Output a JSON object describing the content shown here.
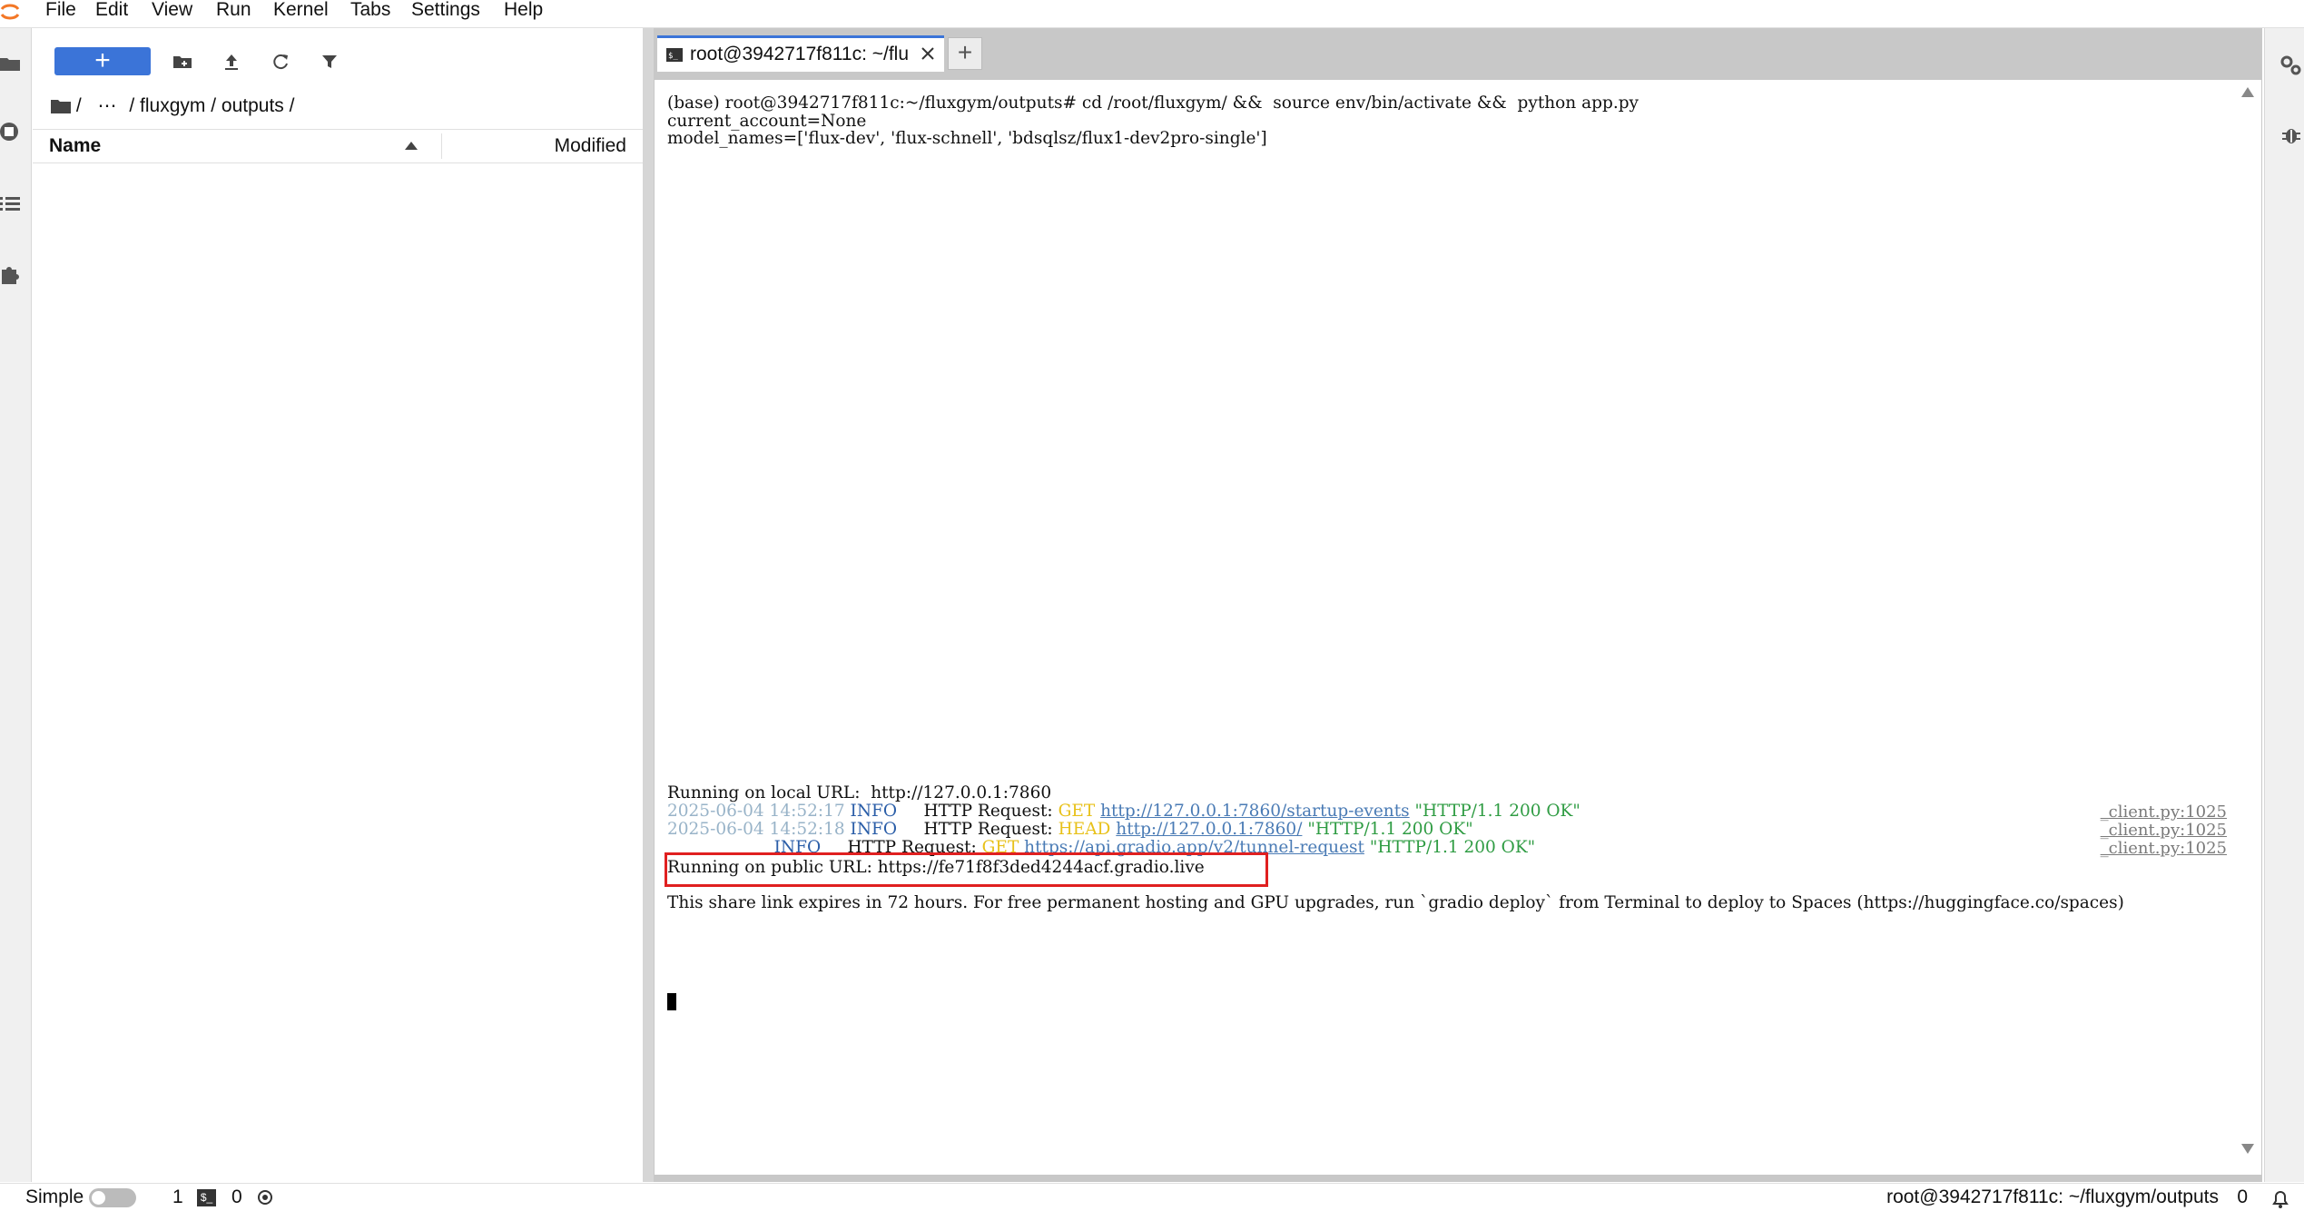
{
  "menubar": {
    "items": [
      "File",
      "Edit",
      "View",
      "Run",
      "Kernel",
      "Tabs",
      "Settings",
      "Help"
    ]
  },
  "filebrowser": {
    "new_button_label": "+",
    "breadcrumb": {
      "root_sep": "/",
      "ellipsis": "⋯",
      "path": "/ fluxgym / outputs /"
    },
    "columns": {
      "name": "Name",
      "modified": "Modified"
    }
  },
  "tabs": {
    "terminal_tab_label": "root@3942717f811c: ~/flu",
    "add_tab_label": "+"
  },
  "terminal": {
    "line_cmd": "(base) root@3942717f811c:~/fluxgym/outputs# cd /root/fluxgym/ &&  source env/bin/activate &&  python app.py",
    "line_account": "current_account=None",
    "line_models": "model_names=['flux-dev', 'flux-schnell', 'bdsqlsz/flux1-dev2pro-single']",
    "line_local": "Running on local URL:  http://127.0.0.1:7860",
    "log1": {
      "ts": "2025-06-04 14:52:17",
      "level": "INFO",
      "req": "HTTP Request:",
      "method": "GET",
      "url": "http://127.0.0.1:7860/startup-events",
      "status": "\"HTTP/1.1 200 OK\"",
      "ref": "_client.py:1025"
    },
    "log2": {
      "ts": "2025-06-04 14:52:18",
      "level": "INFO",
      "req": "HTTP Request:",
      "method": "HEAD",
      "url": "http://127.0.0.1:7860/",
      "status": "\"HTTP/1.1 200 OK\"",
      "ref": "_client.py:1025"
    },
    "log3": {
      "level": "INFO",
      "req": "HTTP Request:",
      "method": "GET",
      "url": "https://api.gradio.app/v2/tunnel-request",
      "status": "\"HTTP/1.1 200 OK\"",
      "ref": "_client.py:1025"
    },
    "line_public": "Running on public URL: https://fe71f8f3ded4244acf.gradio.live",
    "line_share": "This share link expires in 72 hours. For free permanent hosting and GPU upgrades, run `gradio deploy` from Terminal to deploy to Spaces (https://huggingface.co/spaces)"
  },
  "statusbar": {
    "mode_label": "Simple",
    "terminals_count": "1",
    "kernels_count": "0",
    "current_path": "root@3942717f811c: ~/fluxgym/outputs",
    "notifications_count": "0"
  },
  "icons": {
    "accent": "#3b74d8",
    "highlight": "#e02020"
  }
}
